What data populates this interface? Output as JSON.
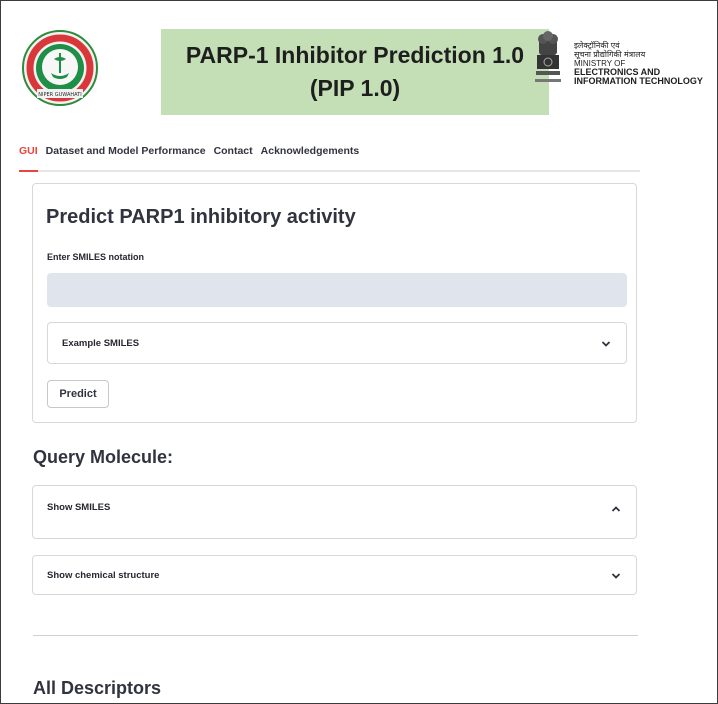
{
  "header": {
    "title_line1": "PARP-1 Inhibitor Prediction 1.0",
    "title_line2": "(PIP 1.0)",
    "logo_text": "NIPER GUWAHATI",
    "ministry_hindi_1": "इलेक्ट्रॉनिकी एवं",
    "ministry_hindi_2": "सूचना प्रौद्योगिकी मंत्रालय",
    "ministry_en_1": "MINISTRY OF",
    "ministry_en_2": "ELECTRONICS AND",
    "ministry_en_3": "INFORMATION TECHNOLOGY",
    "title_bg": "#c4dfb6"
  },
  "tabs": [
    {
      "label": "GUI",
      "active": true
    },
    {
      "label": "Dataset and Model Performance",
      "active": false
    },
    {
      "label": "Contact",
      "active": false
    },
    {
      "label": "Acknowledgements",
      "active": false
    }
  ],
  "predict_card": {
    "heading": "Predict PARP1 inhibitory activity",
    "input_label": "Enter SMILES notation",
    "input_value": "",
    "example_expander": "Example SMILES",
    "predict_button": "Predict"
  },
  "query": {
    "heading": "Query Molecule:",
    "show_smiles": "Show SMILES",
    "show_structure": "Show chemical structure"
  },
  "descriptors": {
    "heading": "All Descriptors"
  },
  "colors": {
    "accent": "#e8453c",
    "input_bg": "#e0e4ec"
  }
}
